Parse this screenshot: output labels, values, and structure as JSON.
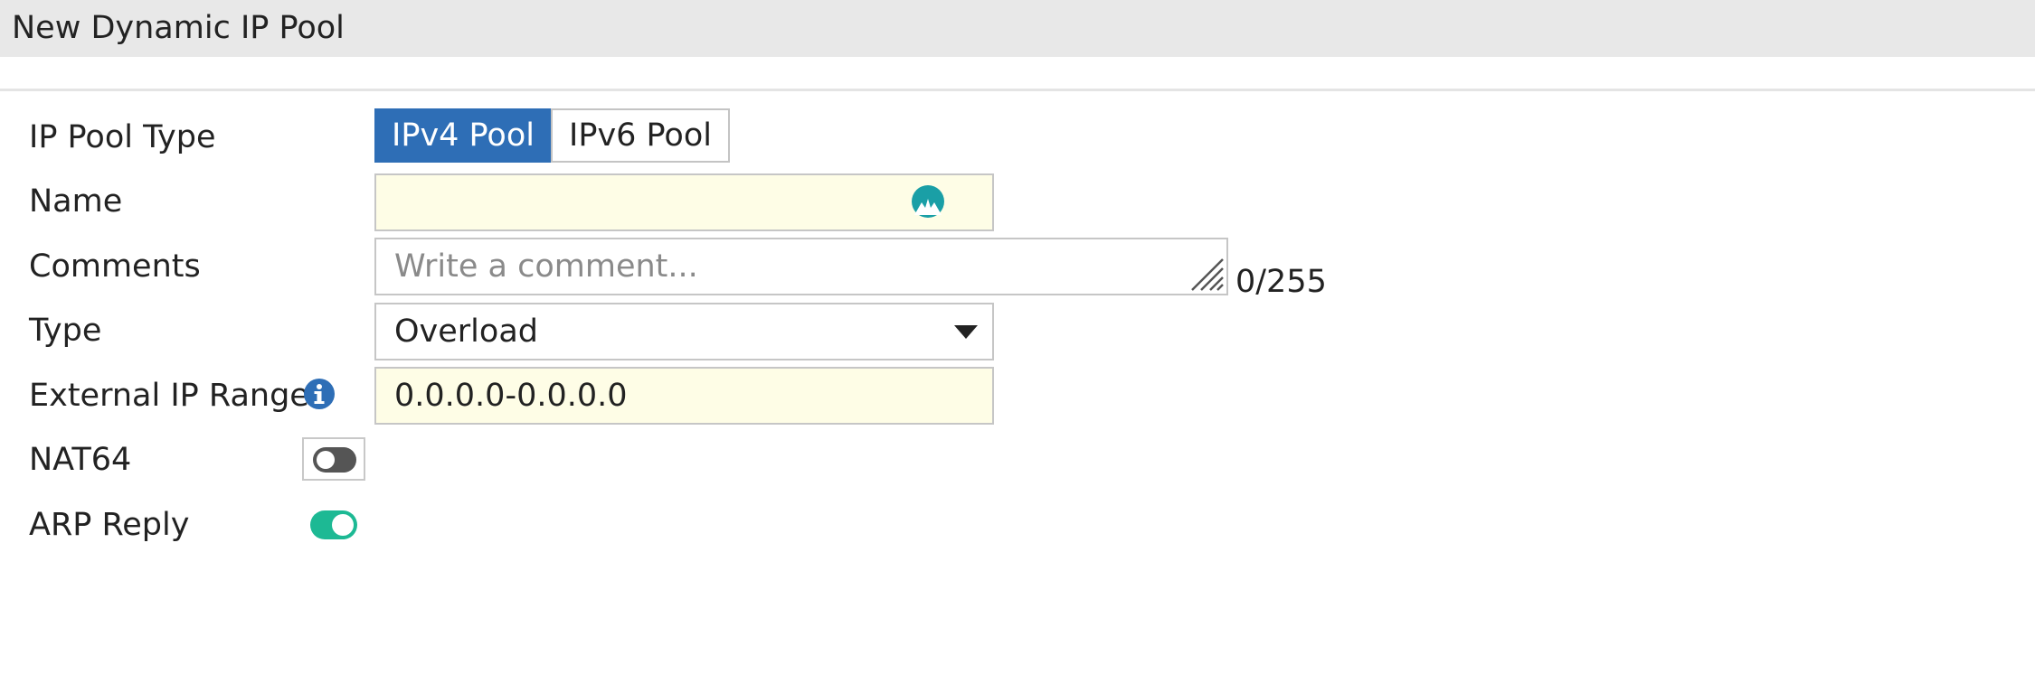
{
  "header": {
    "title": "New Dynamic IP Pool"
  },
  "form": {
    "pool_type": {
      "label": "IP Pool Type",
      "options": [
        "IPv4 Pool",
        "IPv6 Pool"
      ],
      "selected": "IPv4 Pool"
    },
    "name": {
      "label": "Name",
      "value": ""
    },
    "comments": {
      "label": "Comments",
      "placeholder": "Write a comment...",
      "value": "",
      "counter": "0/255"
    },
    "type": {
      "label": "Type",
      "value": "Overload"
    },
    "external_ip_range": {
      "label": "External IP Range",
      "value": "0.0.0.0-0.0.0.0"
    },
    "nat64": {
      "label": "NAT64",
      "enabled": false
    },
    "arp_reply": {
      "label": "ARP Reply",
      "enabled": true
    }
  },
  "icons": {
    "info": "info-icon",
    "name_assist": "avatar-icon",
    "resize": "resize-grip-icon",
    "dropdown": "caret-down-icon"
  },
  "colors": {
    "accent": "#2e6eb6",
    "toggle_on": "#1db994",
    "toggle_off": "#555555",
    "input_highlight": "#fefde6",
    "header_bg": "#e8e8e8"
  }
}
